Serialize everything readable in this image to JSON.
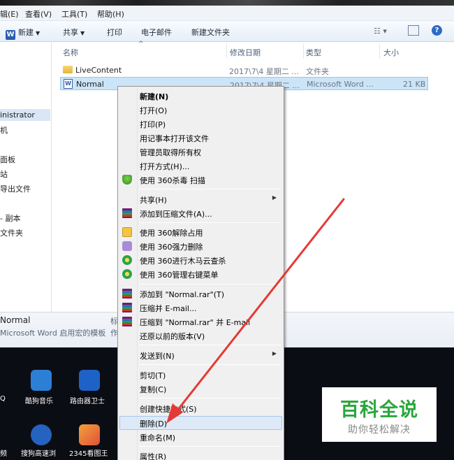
{
  "menubar": {
    "items": [
      "辑(E)",
      "查看(V)",
      "工具(T)",
      "帮助(H)"
    ]
  },
  "toolbar": {
    "new_label": "新建",
    "share_label": "共享",
    "print_label": "打印",
    "email_label": "电子邮件",
    "new_folder_label": "新建文件夹"
  },
  "columns": {
    "name": "名称",
    "modified": "修改日期",
    "type": "类型",
    "size": "大小"
  },
  "files": [
    {
      "name": "LiveContent",
      "modified": "2017\\7\\4 星期二 ...",
      "type": "文件夹",
      "size": ""
    },
    {
      "name": "Normal",
      "modified": "2017\\7\\4 星期二 ...",
      "type": "Microsoft Word ...",
      "size": "21 KB"
    }
  ],
  "navpane": {
    "items": [
      "inistrator",
      "机",
      "面板",
      "站",
      "导出文件",
      "- 副本",
      "文件夹"
    ]
  },
  "details": {
    "name": "Normal",
    "desc": "Microsoft Word 启用宏的模板",
    "extra1": "标",
    "extra2": "作"
  },
  "context_menu": {
    "groups": [
      [
        "新建(N)",
        "打开(O)",
        "打印(P)",
        "用记事本打开该文件",
        "管理员取得所有权",
        "打开方式(H)...",
        "使用 360杀毒 扫描"
      ],
      [
        "共享(H)",
        "添加到压缩文件(A)..."
      ],
      [
        "使用 360解除占用",
        "使用 360强力删除",
        "使用 360进行木马云查杀",
        "使用 360管理右键菜单"
      ],
      [
        "添加到 \"Normal.rar\"(T)",
        "压缩并 E-mail...",
        "压缩到 \"Normal.rar\" 并 E-mail",
        "还原以前的版本(V)"
      ],
      [
        "发送到(N)"
      ],
      [
        "剪切(T)",
        "复制(C)"
      ],
      [
        "创建快捷方式(S)",
        "删除(D)",
        "重命名(M)"
      ],
      [
        "属性(R)"
      ]
    ],
    "highlighted": "删除(D)"
  },
  "desktop": {
    "icons": [
      "Q",
      "酷狗音乐",
      "路由器卫士",
      "频",
      "搜狗高速浏",
      "2345看图王"
    ]
  },
  "watermark": {
    "title": "百科全说",
    "subtitle": "助你轻松解决"
  },
  "colors": {
    "highlight": "#dde9f7",
    "selection": "#cce4f7",
    "arrow": "#e53935",
    "watermark_green": "#29a63b"
  }
}
